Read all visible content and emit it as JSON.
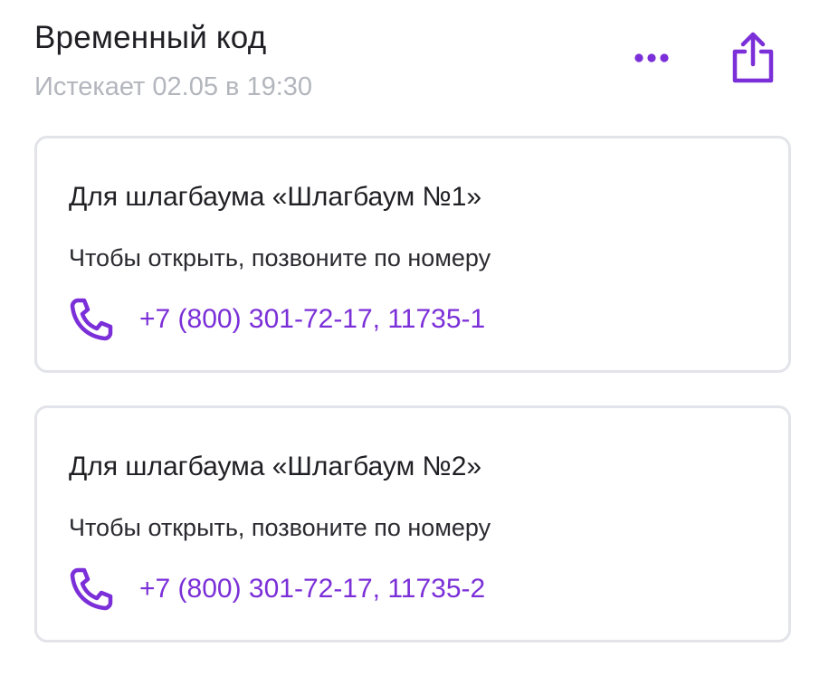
{
  "header": {
    "title": "Временный код",
    "subtitle": "Истекает 02.05 в 19:30"
  },
  "actions": {
    "more_icon": "more-horizontal-icon",
    "share_icon": "share-icon"
  },
  "colors": {
    "accent": "#7b2fd8",
    "text_primary": "#1f1f24",
    "text_secondary": "#b3b6bd",
    "card_border": "#e3e4e9"
  },
  "cards": [
    {
      "title": "Для шлагбаума «Шлагбаум №1»",
      "description": "Чтобы открыть, позвоните по номеру",
      "phone": "+7 (800) 301-72-17, 11735-1",
      "icon": "phone-icon"
    },
    {
      "title": "Для шлагбаума «Шлагбаум №2»",
      "description": "Чтобы открыть, позвоните по номеру",
      "phone": "+7 (800) 301-72-17, 11735-2",
      "icon": "phone-icon"
    }
  ]
}
